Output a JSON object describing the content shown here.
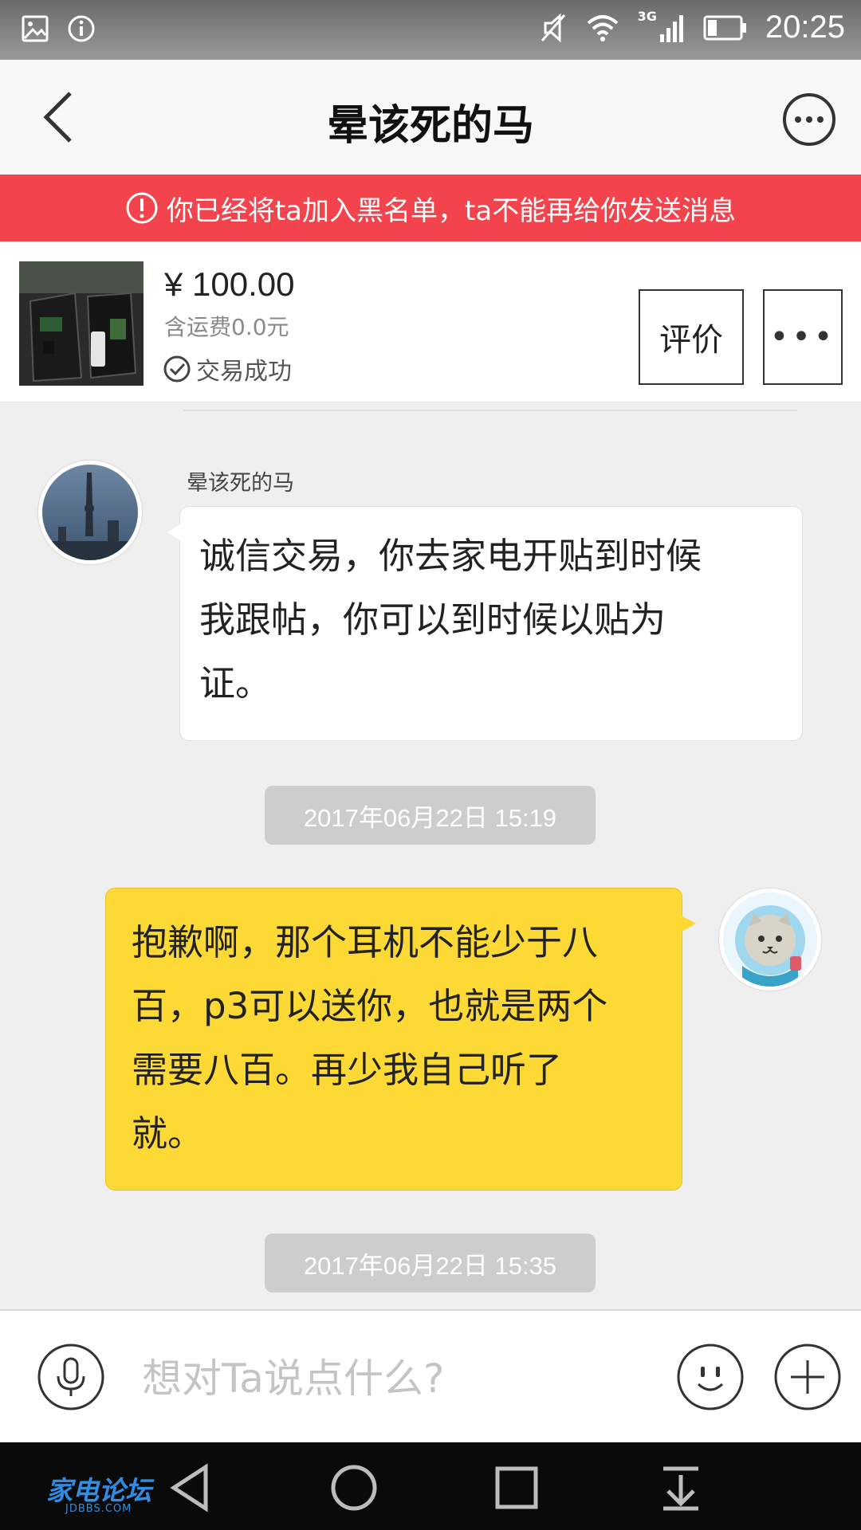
{
  "status_bar": {
    "time": "20:25",
    "network": "3G"
  },
  "header": {
    "title": "晕该死的马"
  },
  "banner": {
    "text": "你已经将ta加入黑名单，ta不能再给你发送消息"
  },
  "product": {
    "price": "¥ 100.00",
    "shipping": "含运费0.0元",
    "status": "交易成功",
    "rate_label": "评价",
    "more_label": "•••"
  },
  "messages": [
    {
      "sender": "晕该死的马",
      "direction": "incoming",
      "text": "诚信交易，你去家电开贴到时候\n我跟帖，你可以到时候以贴为\n证。"
    },
    {
      "timestamp": "2017年06月22日 15:19"
    },
    {
      "direction": "outgoing",
      "text": "抱歉啊，那个耳机不能少于八\n百，p3可以送你，也就是两个\n需要八百。再少我自己听了\n就。"
    },
    {
      "timestamp": "2017年06月22日 15:35"
    }
  ],
  "input": {
    "placeholder": "想对Ta说点什么?"
  },
  "watermark": {
    "main": "家电论坛",
    "sub": "JDBBS.COM"
  },
  "colors": {
    "banner": "#f3444d",
    "outgoing_bubble": "#fdd935",
    "timestamp_bg": "#cdcdcd"
  },
  "icons": [
    "gallery-icon",
    "info-icon",
    "mute-icon",
    "wifi-icon",
    "signal-icon",
    "battery-icon",
    "back-icon",
    "more-icon",
    "alert-icon",
    "check-circle-icon",
    "microphone-icon",
    "emoji-icon",
    "plus-icon",
    "nav-back-icon",
    "nav-home-icon",
    "nav-recents-icon",
    "nav-dropdown-icon"
  ]
}
